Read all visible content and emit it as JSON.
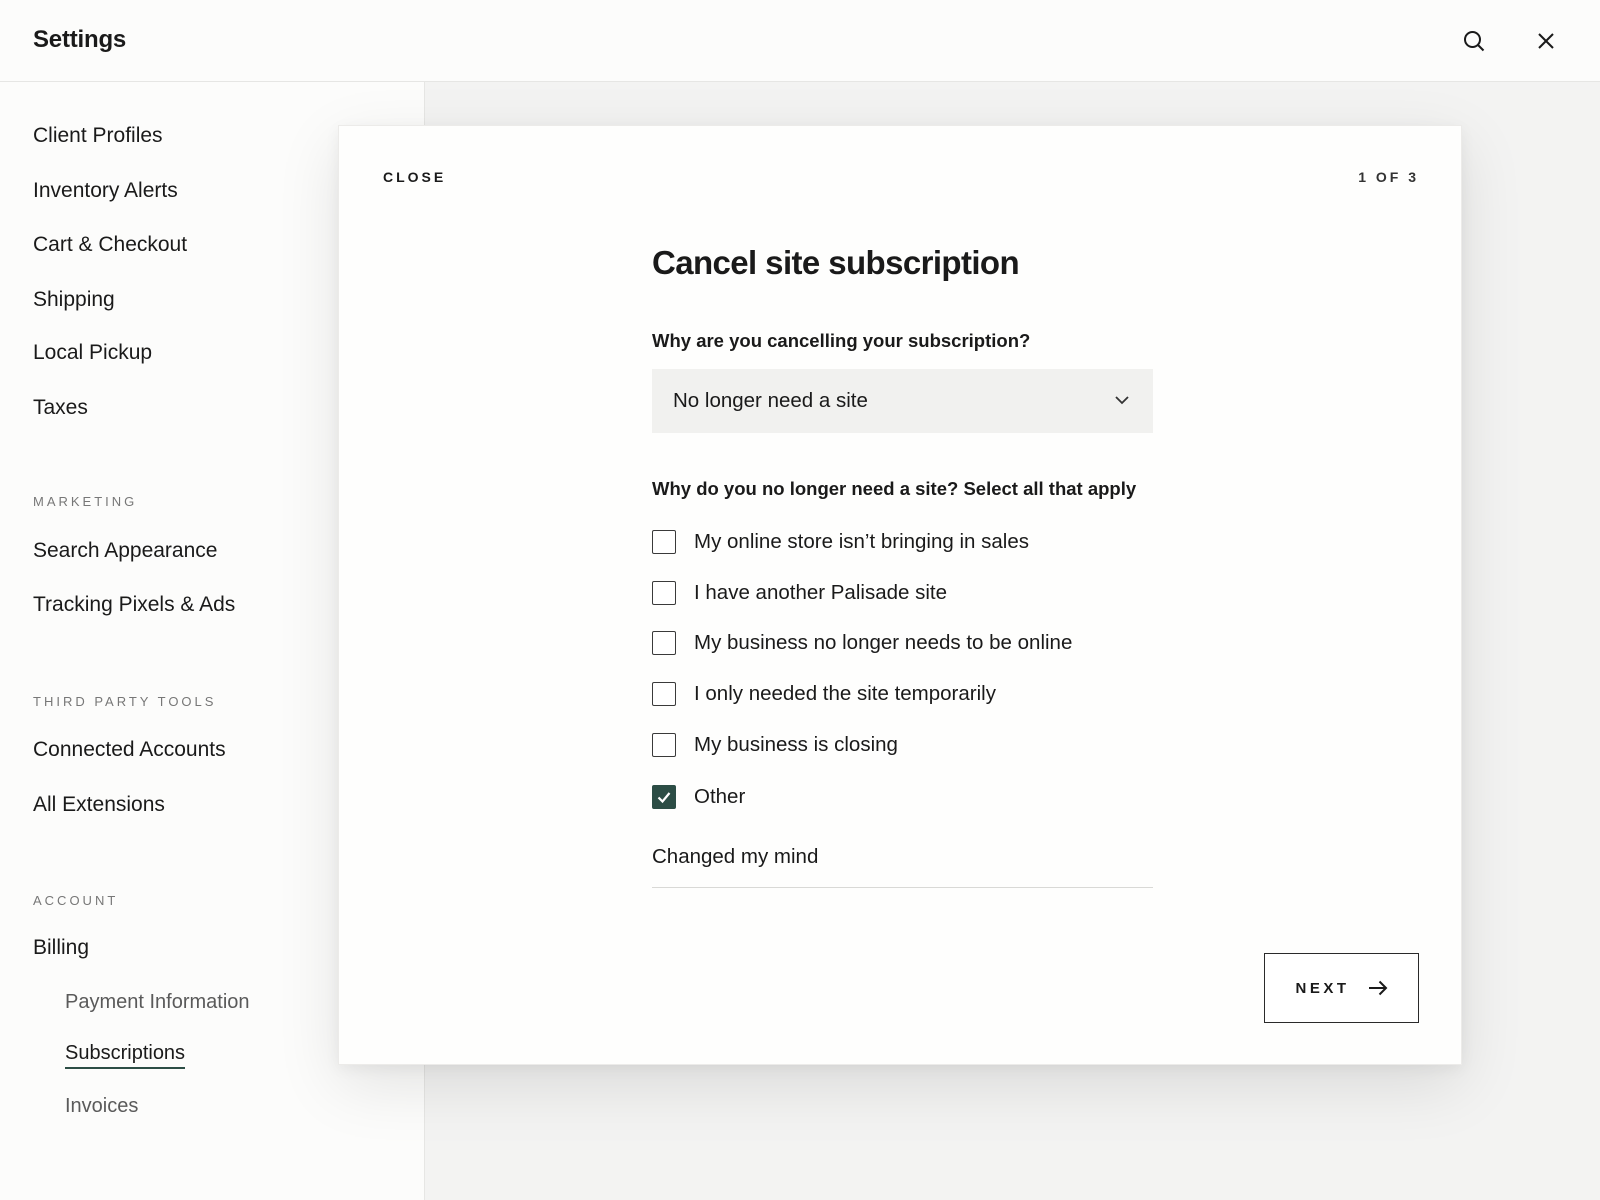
{
  "header": {
    "title": "Settings",
    "search_icon": "search-icon",
    "close_icon": "close-icon"
  },
  "sidebar": {
    "items": [
      {
        "label": "Client Profiles"
      },
      {
        "label": "Inventory Alerts"
      },
      {
        "label": "Cart & Checkout"
      },
      {
        "label": "Shipping"
      },
      {
        "label": "Local Pickup"
      },
      {
        "label": "Taxes"
      }
    ],
    "marketing": {
      "heading": "MARKETING",
      "items": [
        {
          "label": "Search Appearance"
        },
        {
          "label": "Tracking Pixels & Ads"
        }
      ]
    },
    "third_party": {
      "heading": "THIRD PARTY TOOLS",
      "items": [
        {
          "label": "Connected Accounts"
        },
        {
          "label": "All Extensions"
        }
      ]
    },
    "account": {
      "heading": "ACCOUNT",
      "billing": "Billing",
      "sub_items": [
        {
          "label": "Payment Information"
        },
        {
          "label": "Subscriptions",
          "active": true
        },
        {
          "label": "Invoices"
        }
      ]
    }
  },
  "modal": {
    "close_label": "CLOSE",
    "step": "1 OF 3",
    "heading": "Cancel site subscription",
    "question1": "Why are you cancelling your subscription?",
    "select_value": "No longer need a site",
    "question2": "Why do you no longer need a site? Select all that apply",
    "options": [
      {
        "label": "My online store isn’t bringing in sales",
        "checked": false
      },
      {
        "label": "I have another Palisade site",
        "checked": false
      },
      {
        "label": "My business no longer needs to be online",
        "checked": false
      },
      {
        "label": "I only needed the site temporarily",
        "checked": false
      },
      {
        "label": "My business is closing",
        "checked": false
      },
      {
        "label": "Other",
        "checked": true
      }
    ],
    "other_value": "Changed my mind",
    "next_label": "NEXT"
  },
  "colors": {
    "accent": "#2c4d45",
    "background": "#f3f3f2",
    "panel": "#fcfcfb"
  }
}
